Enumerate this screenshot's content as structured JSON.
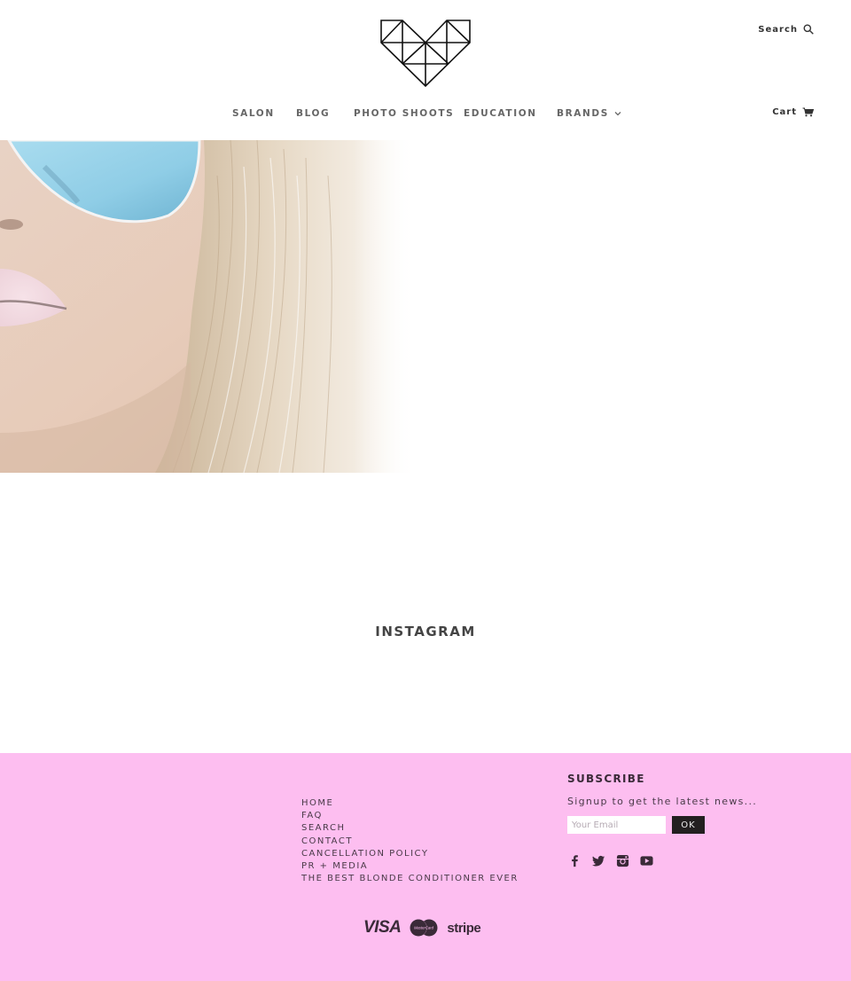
{
  "header": {
    "logo_alt": "Geometric heart logo",
    "search_label": "Search",
    "search_icon": "magnifier-icon",
    "cart_label": "Cart",
    "cart_icon": "shopping-cart-icon"
  },
  "nav": {
    "items": [
      {
        "label": "SALON"
      },
      {
        "label": "BLOG"
      },
      {
        "label": "PHOTO SHOOTS"
      },
      {
        "label": "EDUCATION"
      },
      {
        "label": "BRANDS",
        "has_dropdown": true,
        "icon": "chevron-down-icon"
      }
    ]
  },
  "hero": {
    "description": "Close-up of woman with blonde hair wearing blue mirrored aviator sunglasses and pale pink lips"
  },
  "instagram": {
    "title": "INSTAGRAM"
  },
  "footer": {
    "background": "#fdbef0",
    "links": [
      "HOME",
      "FAQ",
      "SEARCH",
      "CONTACT",
      "CANCELLATION POLICY",
      "PR + MEDIA",
      "THE BEST BLONDE CONDITIONER EVER"
    ],
    "subscribe": {
      "title": "SUBSCRIBE",
      "text": "Signup to get the latest news...",
      "email_placeholder": "Your Email",
      "email_value": "",
      "button_label": "OK"
    },
    "social": [
      "facebook-icon",
      "twitter-icon",
      "instagram-icon",
      "youtube-icon"
    ],
    "payments": {
      "visa": "VISA",
      "mastercard": "MasterCard",
      "stripe": "stripe"
    }
  }
}
